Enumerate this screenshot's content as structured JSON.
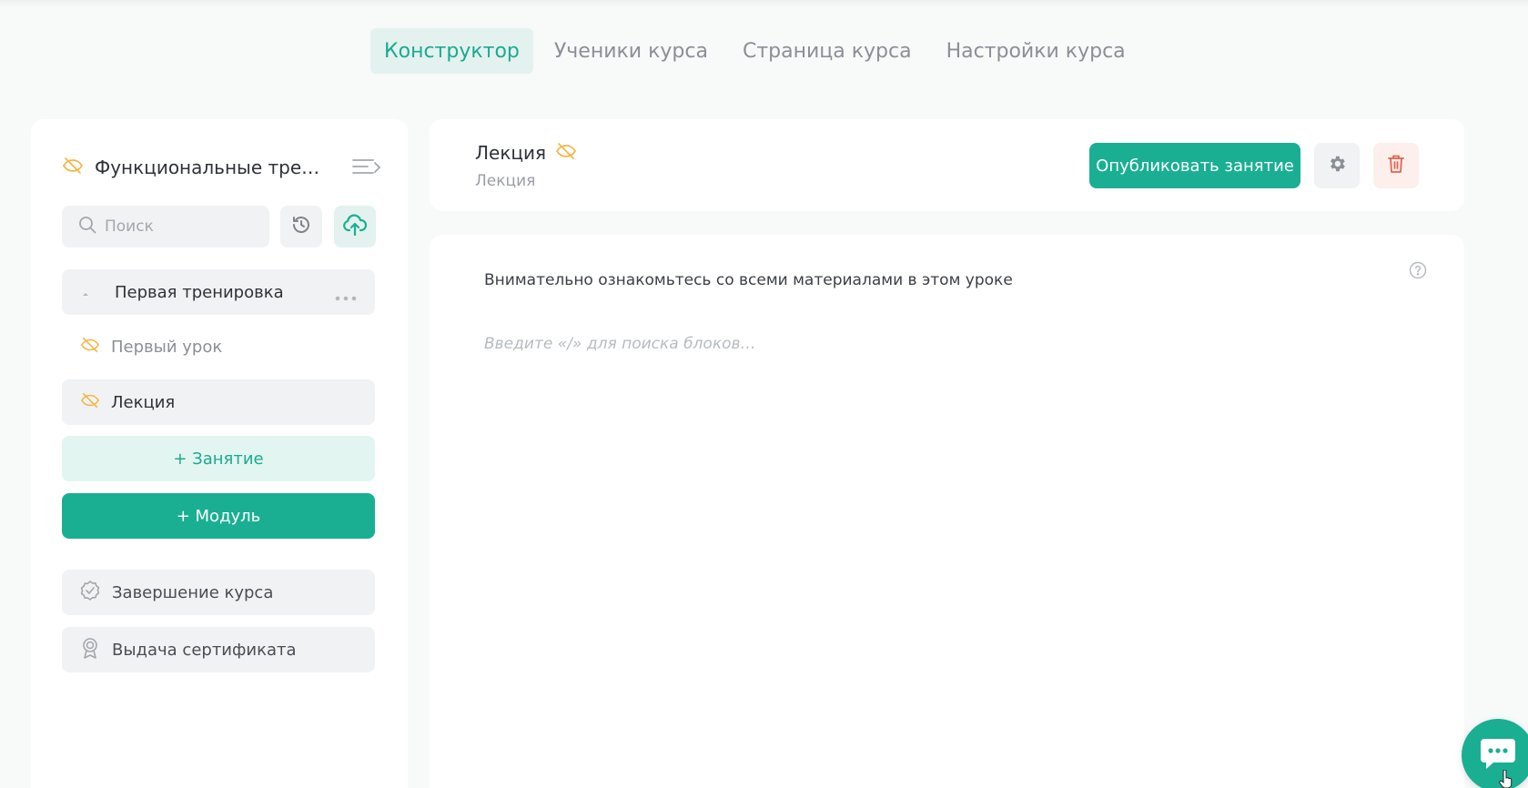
{
  "tabs": [
    {
      "label": "Конструктор",
      "active": true
    },
    {
      "label": "Ученики курса",
      "active": false
    },
    {
      "label": "Страница курса",
      "active": false
    },
    {
      "label": "Настройки курса",
      "active": false
    }
  ],
  "sidebar": {
    "course_title": "Функциональные тренировки",
    "search_placeholder": "Поиск",
    "modules": [
      {
        "title": "Первая тренировка",
        "expanded": true,
        "lessons": [
          {
            "title": "Первый урок",
            "hidden_icon": "eye-off-icon"
          },
          {
            "title": "Лекция",
            "hidden_icon": "eye-off-icon",
            "selected": true
          }
        ]
      }
    ],
    "add_lesson_label": "+ Занятие",
    "add_module_label": "+ Модуль",
    "extras": [
      {
        "title": "Завершение курса",
        "icon": "check-badge-icon"
      },
      {
        "title": "Выдача сертификата",
        "icon": "certificate-icon"
      }
    ]
  },
  "lesson_header": {
    "title": "Лекция",
    "type": "Лекция",
    "publish_label": "Опубликовать занятие",
    "settings_icon": "gear-icon",
    "delete_icon": "trash-icon"
  },
  "content": {
    "instruction": "Внимательно ознакомьтесь со всеми материалами в этом уроке",
    "editor_placeholder": "Введите «/» для поиска блоков…"
  },
  "colors": {
    "accent": "#1aaf93",
    "accent_light": "#e3f5f1",
    "warning_icon": "#f5b547",
    "danger": "#e06650",
    "muted_bg": "#f1f2f4",
    "page_bg": "#f8f9f9"
  }
}
